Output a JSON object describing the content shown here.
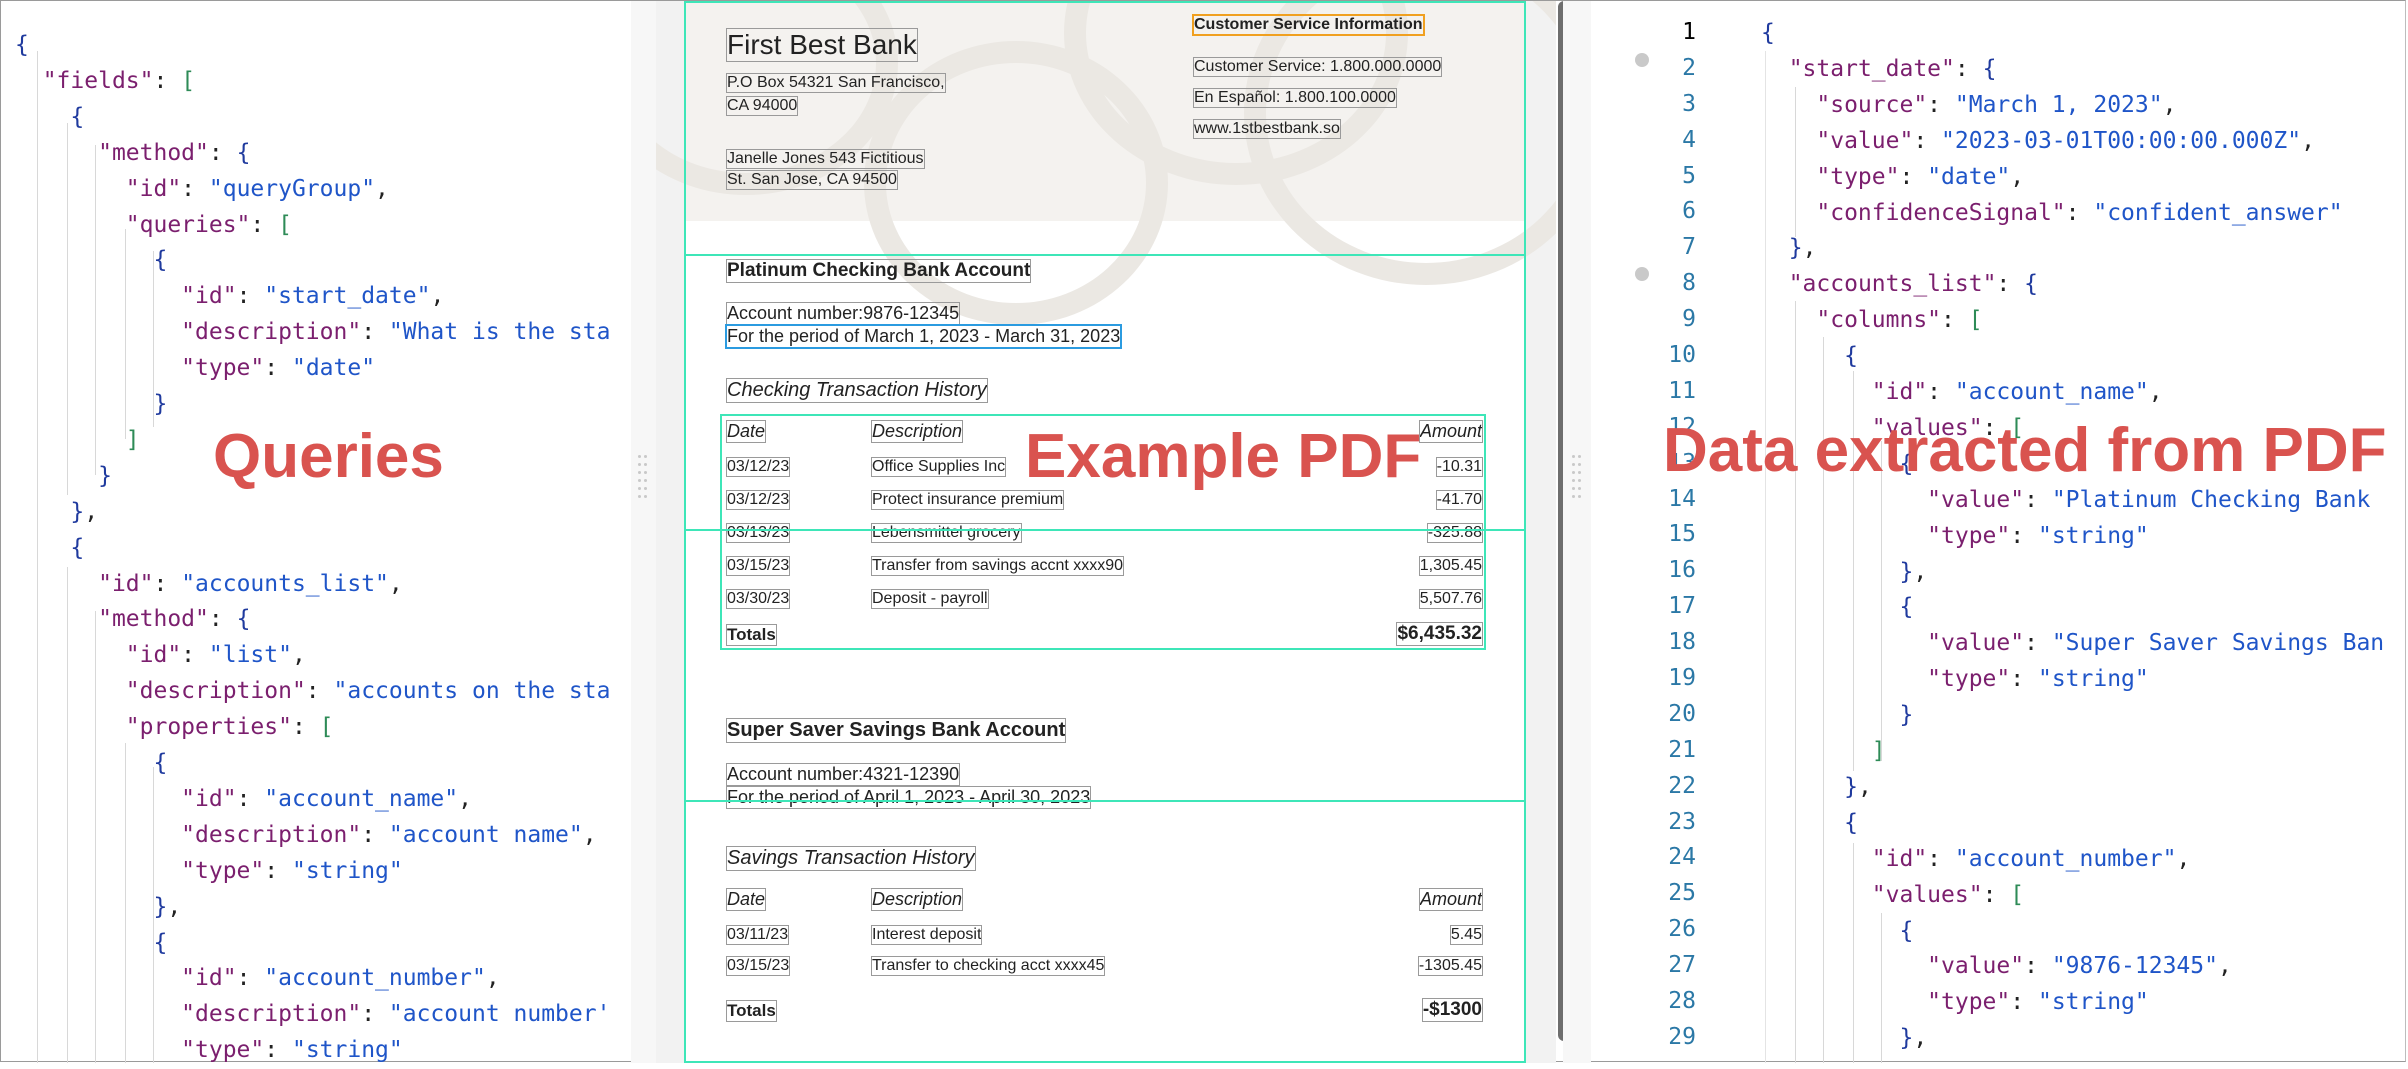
{
  "labels": {
    "queries": "Queries",
    "example_pdf": "Example PDF",
    "data_extracted": "Data extracted from PDF"
  },
  "queries_code": [
    "{",
    "  \"fields\": [",
    "    {",
    "      \"method\": {",
    "        \"id\": \"queryGroup\",",
    "        \"queries\": [",
    "          {",
    "            \"id\": \"start_date\",",
    "            \"description\": \"What is the sta",
    "            \"type\": \"date\"",
    "          }",
    "        ]",
    "      }",
    "    },",
    "    {",
    "      \"id\": \"accounts_list\",",
    "      \"method\": {",
    "        \"id\": \"list\",",
    "        \"description\": \"accounts on the sta",
    "        \"properties\": [",
    "          {",
    "            \"id\": \"account_name\",",
    "            \"description\": \"account name\",",
    "            \"type\": \"string\"",
    "          },",
    "          {",
    "            \"id\": \"account_number\",",
    "            \"description\": \"account number'",
    "            \"type\": \"string\""
  ],
  "extracted_code": [
    "{",
    "  \"start_date\": {",
    "    \"source\": \"March 1, 2023\",",
    "    \"value\": \"2023-03-01T00:00:00.000Z\",",
    "    \"type\": \"date\",",
    "    \"confidenceSignal\": \"confident_answer\"",
    "  },",
    "  \"accounts_list\": {",
    "    \"columns\": [",
    "      {",
    "        \"id\": \"account_name\",",
    "        \"values\": [",
    "          {",
    "            \"value\": \"Platinum Checking Bank",
    "            \"type\": \"string\"",
    "          },",
    "          {",
    "            \"value\": \"Super Saver Savings Ban",
    "            \"type\": \"string\"",
    "          }",
    "        ]",
    "      },",
    "      {",
    "        \"id\": \"account_number\",",
    "        \"values\": [",
    "          {",
    "            \"value\": \"9876-12345\",",
    "            \"type\": \"string\"",
    "          },"
  ],
  "line_numbers": [
    "1",
    "2",
    "3",
    "4",
    "5",
    "6",
    "7",
    "8",
    "9",
    "10",
    "11",
    "12",
    "13",
    "14",
    "15",
    "16",
    "17",
    "18",
    "19",
    "20",
    "21",
    "22",
    "23",
    "24",
    "25",
    "26",
    "27",
    "28",
    "29"
  ],
  "pdf": {
    "bank_name": "First Best Bank",
    "bank_addr_1": "P.O Box 54321 San Francisco,",
    "bank_addr_2": "CA 94000",
    "cust_name_1": "Janelle Jones 543 Fictitious",
    "cust_name_2": "St. San Jose, CA 94500",
    "cs_title": "Customer Service Information",
    "cs_phone": "Customer Service: 1.800.000.0000",
    "cs_espanol": "En Español: 1.800.100.0000",
    "cs_web": "www.1stbestbank.so",
    "acct1": {
      "title": "Platinum Checking Bank Account",
      "number": "Account number:9876-12345",
      "period": "For the period of March 1, 2023 - March 31, 2023",
      "history_title": "Checking Transaction History",
      "headers": [
        "Date",
        "Description",
        "Amount"
      ],
      "rows": [
        [
          "03/12/23",
          "Office Supplies Inc",
          "-10.31"
        ],
        [
          "03/12/23",
          "Protect insurance premium",
          "-41.70"
        ],
        [
          "03/13/23",
          "Lebensmittel grocery",
          "-325.88"
        ],
        [
          "03/15/23",
          "Transfer from savings accnt xxxx90",
          "1,305.45"
        ],
        [
          "03/30/23",
          "Deposit - payroll",
          "5,507.76"
        ]
      ],
      "totals_label": "Totals",
      "totals_value": "$6,435.32"
    },
    "acct2": {
      "title": "Super Saver Savings Bank Account",
      "number": "Account number:4321-12390",
      "period": "For the period of April 1, 2023 - April 30, 2023",
      "history_title": "Savings Transaction History",
      "headers": [
        "Date",
        "Description",
        "Amount"
      ],
      "rows": [
        [
          "03/11/23",
          "Interest deposit",
          "5.45"
        ],
        [
          "03/15/23",
          "Transfer to checking acct xxxx45",
          "-1305.45"
        ]
      ],
      "totals_label": "Totals",
      "totals_value": "-$1300"
    }
  }
}
